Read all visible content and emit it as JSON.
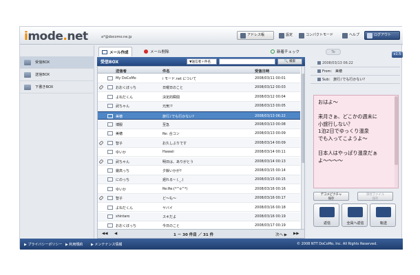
{
  "header": {
    "logo": "imode.net",
    "account": "a*@docomo.ne.jp",
    "address_btn": "アドレス帳",
    "settings_btn": "設定",
    "compact_btn": "コンパクトモード",
    "help_btn": "ヘルプ",
    "logout_btn": "ログアウト"
  },
  "sidebar": {
    "items": [
      {
        "label": "受信BOX"
      },
      {
        "label": "送信BOX"
      },
      {
        "label": "下書きBOX"
      }
    ]
  },
  "toolbar": {
    "compose": "メール作成",
    "delete": "メール削除",
    "new_check": "新着チェック"
  },
  "inbox": {
    "title": "受信BOX",
    "search_scope": "▼送信者＋件名",
    "search_value": "",
    "search_button": "検索"
  },
  "list": {
    "headers": {
      "sender": "送信者",
      "subject": "件名",
      "date": "受信日時"
    },
    "rows": [
      {
        "sender": "My DoCoMo",
        "subject": "i モード.net について",
        "date": "2008/03/11 00:01",
        "attach": false,
        "read": false
      },
      {
        "sender": "おおくぼっち",
        "subject": "日曜日のこと",
        "date": "2008/03/12 00:03",
        "attach": true,
        "read": false
      },
      {
        "sender": "よねだくん",
        "subject": "決定的瞬間",
        "date": "2008/03/12 00:04",
        "attach": false,
        "read": false
      },
      {
        "sender": "武ちゃん",
        "subject": "元気!?",
        "date": "2008/03/13 00:05",
        "attach": false,
        "read": false
      },
      {
        "sender": "美穂",
        "subject": "旅行♪でも行かない?",
        "date": "2008/03/13 06:22",
        "attach": false,
        "read": true,
        "selected": true
      },
      {
        "sender": "博服",
        "subject": "至急",
        "date": "2008/03/13 00:08",
        "attach": false,
        "read": false
      },
      {
        "sender": "美穂",
        "subject": "Re: 合コン",
        "date": "2008/03/13 00:09",
        "attach": false,
        "read": false
      },
      {
        "sender": "智子",
        "subject": "お久しぶりです",
        "date": "2008/03/14 00:09",
        "attach": true,
        "read": false
      },
      {
        "sender": "ゆいか",
        "subject": "Hawaii",
        "date": "2008/03/14 00:11",
        "attach": false,
        "read": false
      },
      {
        "sender": "武ちゃん",
        "subject": "明日は、ありがとう",
        "date": "2008/03/14 00:13",
        "attach": true,
        "read": false
      },
      {
        "sender": "厳高っち",
        "subject": "夕飯いかが?",
        "date": "2008/03/15 00:14",
        "attach": false,
        "read": false
      },
      {
        "sender": "にのっち",
        "subject": "遅れる~ (._.)",
        "date": "2008/03/15 00:15",
        "attach": false,
        "read": false
      },
      {
        "sender": "ゆいか",
        "subject": "Re:Re:(*^o^*)",
        "date": "2008/03/16 00:16",
        "attach": false,
        "read": false
      },
      {
        "sender": "智子",
        "subject": "ど～も～",
        "date": "2008/03/16 00:17",
        "attach": true,
        "read": false
      },
      {
        "sender": "よねだくん",
        "subject": "ヤバイ",
        "date": "2008/03/16 00:18",
        "attach": false,
        "read": false
      },
      {
        "sender": "shintaro",
        "subject": "スキだよ",
        "date": "2008/03/16 00:19",
        "attach": false,
        "read": false
      },
      {
        "sender": "おおくぼっち",
        "subject": "今日のこと",
        "date": "2008/03/17 00:19",
        "attach": false,
        "read": false
      }
    ]
  },
  "pager": {
    "first": "◀◀",
    "prev": "◀",
    "text": "1 － 30 件目 ／ 31 件",
    "next": "次へ ▶",
    "last": "▶▶"
  },
  "detail": {
    "to_label": "To",
    "zoom": "x1.5",
    "date": "2008/03/13 06:22",
    "from_label": "From：",
    "from": "美穂",
    "sub_label": "Sub：",
    "subject": "旅行♪でも行かない?",
    "body": "おはよ～\n\n来月さぁ、どこかの週末に\n小旅行しない？\n1泊2日でゆっくり温泉\nでも入ってこようよ～\n\n日本人はやっぱり温泉だぁ\nよ～～～～",
    "save_deco": "デコメピクチャ\n保存",
    "save_attach": "添付ファイル\n保存",
    "reply": "返信",
    "reply_all": "全員へ返信",
    "forward": "転送"
  },
  "footer": {
    "privacy": "▶ プライバシーポリシー",
    "terms": "▶ 利用規約",
    "maintenance": "▶ メンテナンス情報",
    "copyright": "© 2008 NTT DoCoMo, Inc. All Rights Reserved."
  },
  "colors": {
    "accent": "#2c4a7c",
    "selected_row": "#4e86c6",
    "body_bg": "#fbe5ec",
    "logo_orange": "#f08a00"
  }
}
